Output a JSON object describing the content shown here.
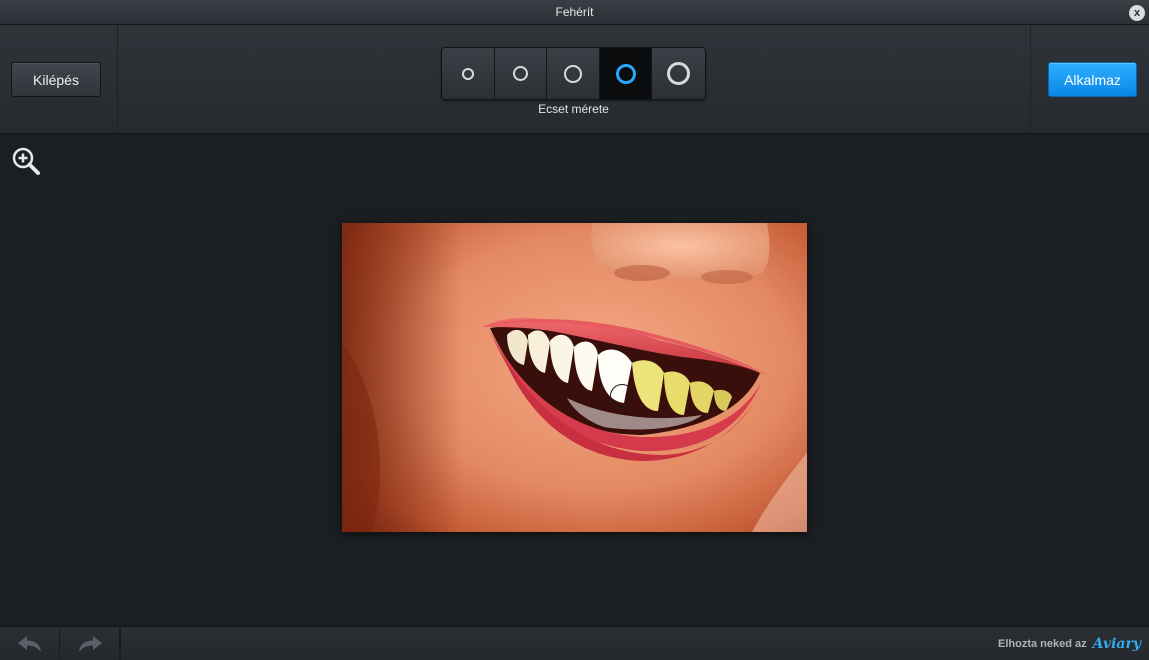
{
  "window": {
    "title": "Fehérít",
    "close_label": "x"
  },
  "toolbar": {
    "exit_label": "Kilépés",
    "apply_label": "Alkalmaz",
    "brush_size_label": "Ecset mérete",
    "brush_sizes": [
      {
        "name": "brush-size-1",
        "active": false
      },
      {
        "name": "brush-size-2",
        "active": false
      },
      {
        "name": "brush-size-3",
        "active": false
      },
      {
        "name": "brush-size-4",
        "active": true
      },
      {
        "name": "brush-size-5",
        "active": false
      }
    ]
  },
  "canvas": {
    "zoom_icon": "zoom-in-icon",
    "photo_subject": "smiling mouth with teeth"
  },
  "footer": {
    "undo_icon": "undo-icon",
    "redo_icon": "redo-icon",
    "credit_text": "Elhozta neked az",
    "brand": "Aviary"
  },
  "colors": {
    "accent": "#1a9bf5",
    "active_ring": "#2aa6ff",
    "background": "#1b1e22"
  }
}
